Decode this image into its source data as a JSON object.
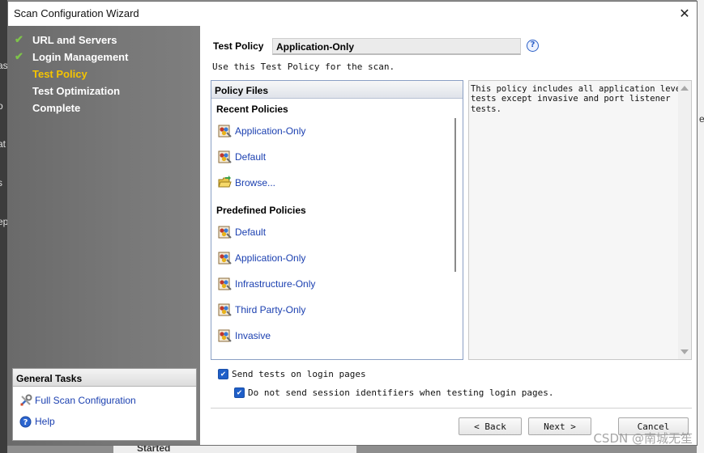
{
  "background": {
    "left_fragments": [
      "as",
      "o",
      "at",
      "s",
      "ep"
    ],
    "right_fragment": "e",
    "bottom_fragment": "Started"
  },
  "dialog": {
    "title": "Scan Configuration Wizard",
    "close_glyph": "✕"
  },
  "nav": {
    "items": [
      {
        "label": "URL and Servers",
        "done": true
      },
      {
        "label": "Login Management",
        "done": true
      },
      {
        "label": "Test Policy",
        "done": false,
        "active": true
      },
      {
        "label": "Test Optimization",
        "done": false
      },
      {
        "label": "Complete",
        "done": false
      }
    ]
  },
  "general_tasks": {
    "header": "General Tasks",
    "items": [
      {
        "label": "Full Scan Configuration",
        "icon": "tools-icon"
      },
      {
        "label": "Help",
        "icon": "help-icon"
      }
    ]
  },
  "test_policy": {
    "label": "Test Policy",
    "value": "Application-Only",
    "help_glyph": "?",
    "description": "Use this Test Policy for the scan."
  },
  "policy_files": {
    "header": "Policy Files",
    "recent_header": "Recent Policies",
    "recent": [
      "Application-Only",
      "Default",
      "Browse..."
    ],
    "predefined_header": "Predefined Policies",
    "predefined": [
      "Default",
      "Application-Only",
      "Infrastructure-Only",
      "Third Party-Only",
      "Invasive"
    ]
  },
  "policy_description": "This policy includes all application level\ntests except invasive and port listener\ntests.",
  "options": {
    "send_tests_on_login": {
      "label": "Send tests on login pages",
      "checked": true
    },
    "no_session_ids": {
      "label": "Do not send session identifiers when testing login pages.",
      "checked": true
    }
  },
  "buttons": {
    "back": "< Back",
    "next": "Next >",
    "cancel": "Cancel"
  },
  "watermark": "CSDN @南城无笙",
  "colors": {
    "active_step": "#f5c400",
    "check_green": "#7ec44a",
    "link_blue": "#1a3fb0",
    "checkbox_blue": "#1f5fc8"
  }
}
